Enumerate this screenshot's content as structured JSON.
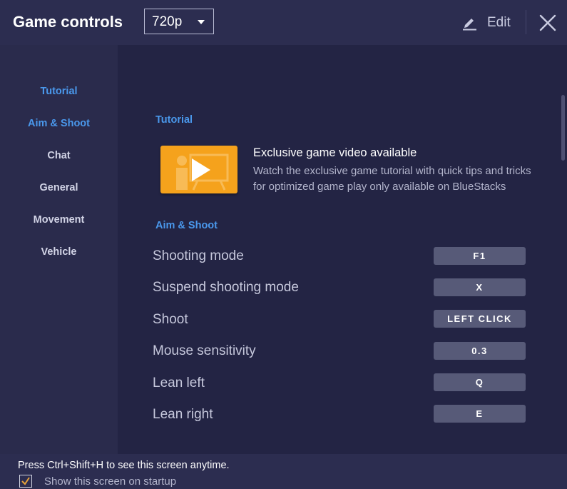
{
  "header": {
    "title": "Game controls",
    "resolution": "720p",
    "edit_label": "Edit",
    "icons": [
      "pencil-icon",
      "close-icon",
      "chevron-down-icon"
    ]
  },
  "sidebar": {
    "items": [
      {
        "label": "Tutorial",
        "active": true
      },
      {
        "label": "Aim & Shoot",
        "active": true
      },
      {
        "label": "Chat",
        "active": false
      },
      {
        "label": "General",
        "active": false
      },
      {
        "label": "Movement",
        "active": false
      },
      {
        "label": "Vehicle",
        "active": false
      }
    ]
  },
  "tutorial": {
    "section_title": "Tutorial",
    "video_title": "Exclusive game video available",
    "video_description": "Watch the exclusive game tutorial with quick tips and tricks for optimized game play only available on BlueStacks",
    "thumbnail_icon": "play-video-icon"
  },
  "aim_shoot": {
    "section_title": "Aim & Shoot",
    "controls": [
      {
        "label": "Shooting mode",
        "key": "F1"
      },
      {
        "label": "Suspend shooting mode",
        "key": "X"
      },
      {
        "label": "Shoot",
        "key": "LEFT CLICK"
      },
      {
        "label": "Mouse sensitivity",
        "key": "0.3"
      },
      {
        "label": "Lean left",
        "key": "Q"
      },
      {
        "label": "Lean right",
        "key": "E"
      }
    ]
  },
  "footer": {
    "hint": "Press Ctrl+Shift+H to see this screen anytime.",
    "startup_label": "Show this screen on startup",
    "startup_checked": true
  },
  "colors": {
    "accent": "#4a98ec",
    "background": "#232444",
    "header": "#2c2d50",
    "thumbnail": "#f5a21c",
    "checkmark": "#e8a33a"
  }
}
